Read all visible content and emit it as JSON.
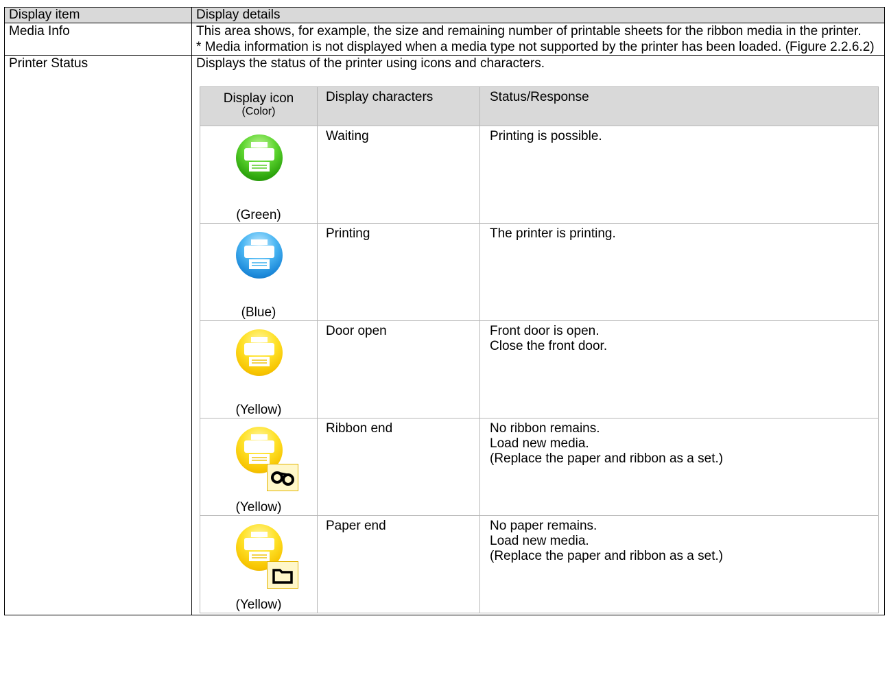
{
  "header": {
    "col1": "Display item",
    "col2": "Display details"
  },
  "media_info": {
    "label": "Media Info",
    "line1": "This area shows, for example, the size and remaining number of printable sheets for the ribbon media in the printer.",
    "line2": "* Media information is not displayed when a media type not supported by the printer has been loaded. (Figure 2.2.6.2)"
  },
  "printer_status": {
    "label": "Printer Status",
    "intro": "Displays the status of the printer using icons and characters.",
    "table_header": {
      "icon": "Display icon",
      "icon_sub": "(Color)",
      "chars": "Display characters",
      "status": "Status/Response"
    },
    "rows": [
      {
        "icon": "printer-green-icon",
        "color": "(Green)",
        "chars": "Waiting",
        "lines": [
          "Printing is possible."
        ]
      },
      {
        "icon": "printer-blue-icon",
        "color": "(Blue)",
        "chars": "Printing",
        "lines": [
          "The printer is printing."
        ]
      },
      {
        "icon": "printer-yellow-icon",
        "color": "(Yellow)",
        "chars": "Door open",
        "lines": [
          "Front door is open.",
          "Close the front door."
        ]
      },
      {
        "icon": "printer-yellow-ribbon-icon",
        "color": "(Yellow)",
        "chars": "Ribbon end",
        "lines": [
          "No ribbon remains.",
          "Load new media.",
          "(Replace the paper and ribbon as a set.)"
        ]
      },
      {
        "icon": "printer-yellow-paper-icon",
        "color": "(Yellow)",
        "chars": "Paper end",
        "lines": [
          "No paper remains.",
          "Load new media.",
          "(Replace the paper and ribbon as a set.)"
        ]
      }
    ]
  },
  "colors": {
    "header_bg": "#d9d9d9",
    "green": "#2ca40c",
    "blue": "#1b88d9",
    "yellow": "#f7c400"
  }
}
